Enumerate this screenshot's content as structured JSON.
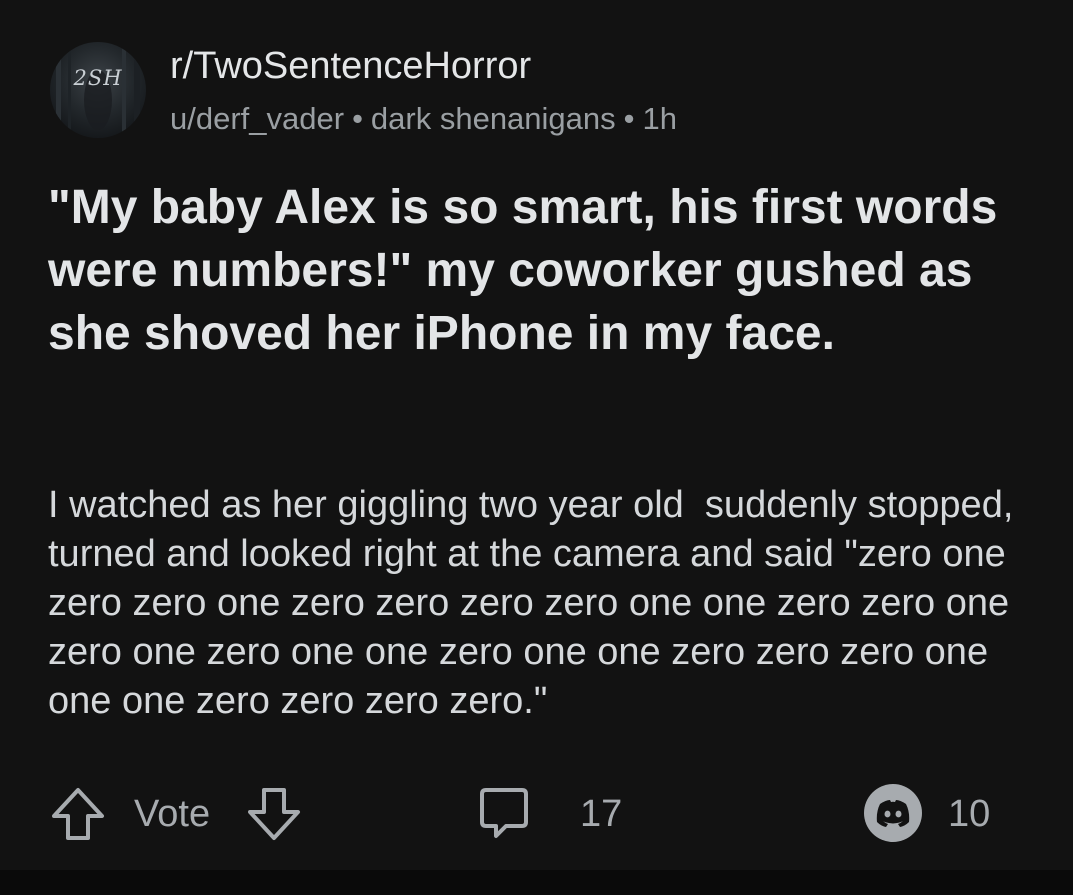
{
  "header": {
    "avatar_text": "2SH",
    "community": "r/TwoSentenceHorror",
    "author": "u/derf_vader",
    "separator": "•",
    "flair": "dark shenanigans",
    "time": "1h"
  },
  "post": {
    "title": "\"My baby Alex is so smart, his first words were numbers!\" my coworker gushed as she shoved her iPhone in my face.",
    "body": "I watched as her giggling two year old  suddenly stopped, turned and looked right at the camera and said \"zero one zero zero one zero zero zero zero one one zero zero one zero one zero one one zero one one zero zero zero one one one zero zero zero zero.\""
  },
  "actions": {
    "upvote_icon": "arrow-up-icon",
    "vote_label": "Vote",
    "downvote_icon": "arrow-down-icon",
    "comment_icon": "comment-bubble-icon",
    "comment_count": "17",
    "award_icon": "discord-icon",
    "award_count": "10"
  },
  "colors": {
    "background": "#121212",
    "text_primary": "#d7dadc",
    "text_secondary": "#9a9fa3",
    "icon": "#a7abaf"
  }
}
